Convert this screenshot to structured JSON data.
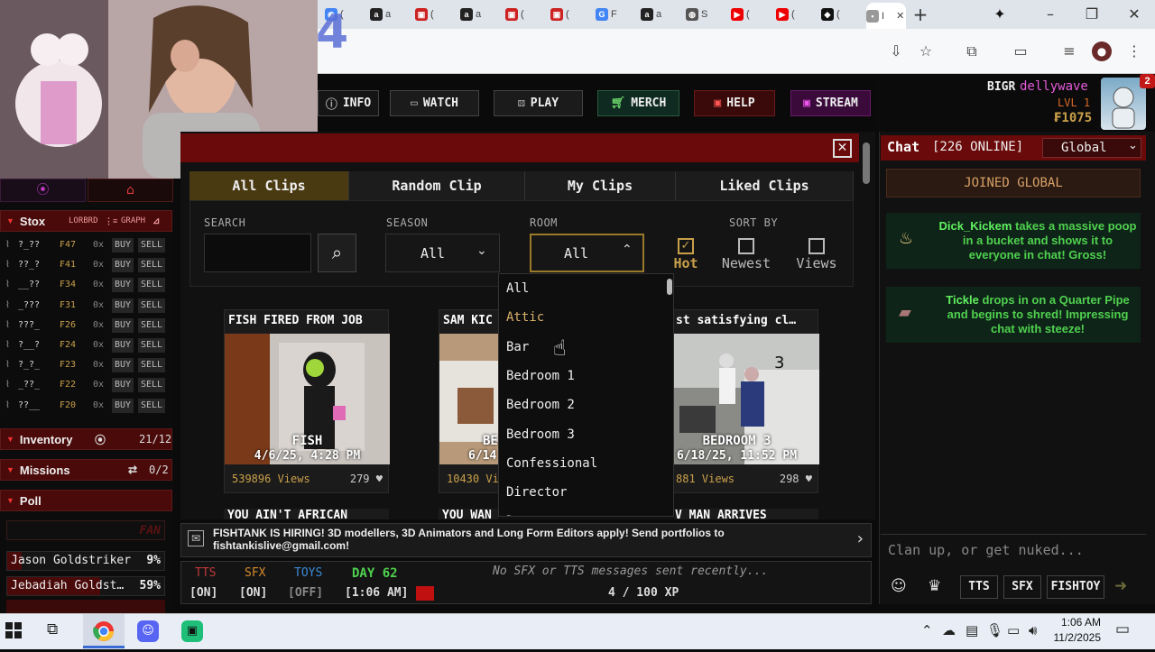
{
  "browser": {
    "tabs": [
      "(",
      "a",
      "(",
      "a",
      "(",
      "(",
      "F",
      "a",
      "S",
      "(",
      "(",
      "(",
      "I"
    ],
    "tab_icons": [
      "chrome-icon",
      "amazon-icon",
      "lolcow-icon",
      "amazon-icon",
      "lolcow-icon",
      "lolcow-icon",
      "google-icon",
      "amazon-icon",
      "site-icon",
      "youtube-icon",
      "youtube-icon",
      "fish-icon",
      "fishtank-icon"
    ],
    "overlay_number": "4"
  },
  "nav": {
    "info": "INFO",
    "watch": "WATCH",
    "play": "PLAY",
    "merch": "MERCH",
    "help": "HELP",
    "stream": "STREAM"
  },
  "user": {
    "tag": "BIGR",
    "name": "dellywave",
    "level": "LVL 1",
    "coins": "₣1075",
    "notif": "2"
  },
  "stox": {
    "title": "Stox",
    "lorbrd": "LORBRD",
    "graph": "GRAPH",
    "rows": [
      {
        "name": "?_??",
        "price": "₣47",
        "qty": "0x"
      },
      {
        "name": "??_?",
        "price": "₣41",
        "qty": "0x"
      },
      {
        "name": "__??",
        "price": "₣34",
        "qty": "0x"
      },
      {
        "name": "_???",
        "price": "₣31",
        "qty": "0x"
      },
      {
        "name": "???_",
        "price": "₣26",
        "qty": "0x"
      },
      {
        "name": "?__?",
        "price": "₣24",
        "qty": "0x"
      },
      {
        "name": "?_?_",
        "price": "₣23",
        "qty": "0x"
      },
      {
        "name": "_??_",
        "price": "₣22",
        "qty": "0x"
      },
      {
        "name": "??__",
        "price": "₣20",
        "qty": "0x"
      }
    ],
    "buy": "BUY",
    "sell": "SELL"
  },
  "inventory": {
    "title": "Inventory",
    "count": "21/12"
  },
  "missions": {
    "title": "Missions",
    "count": "0/2"
  },
  "poll": {
    "title": "Poll",
    "banner": "FAN",
    "options": [
      {
        "name": "Jason Goldstriker",
        "pct": "9%",
        "fill": 0.09
      },
      {
        "name": "Jebadiah Goldst…",
        "pct": "59%",
        "fill": 0.59
      }
    ]
  },
  "clips": {
    "tabs": [
      "All Clips",
      "Random Clip",
      "My Clips",
      "Liked Clips"
    ],
    "search_label": "SEARCH",
    "season_label": "SEASON",
    "season_value": "All",
    "room_label": "ROOM",
    "room_value": "All",
    "sort_label": "SORT BY",
    "sort": [
      {
        "label": "Hot",
        "checked": true
      },
      {
        "label": "Newest",
        "checked": false
      },
      {
        "label": "Views",
        "checked": false
      }
    ],
    "cards": [
      {
        "title": "FISH FIRED FROM JOB",
        "room": "FISH",
        "date": "4/6/25, 4:28 PM",
        "views": "539896 Views",
        "likes": "279"
      },
      {
        "title": "SAM KIC",
        "room": "BE",
        "date": "6/14",
        "views": "10430 Vi",
        "likes": ""
      },
      {
        "title": "st satisfying cl…",
        "room": "BEDROOM 3",
        "date": "6/18/25, 11:52 PM",
        "views": "881 Views",
        "likes": "298"
      }
    ],
    "next_row": [
      "YOU AIN'T AFRICAN",
      "YOU WAN",
      "V MAN ARRIVES"
    ],
    "room_options": [
      "All",
      "Attic",
      "Bar",
      "Bedroom 1",
      "Bedroom 2",
      "Bedroom 3",
      "Confessional",
      "Director",
      "Dorm"
    ]
  },
  "hiring": "FISHTANK IS HIRING! 3D modellers, 3D Animators and Long Form Editors apply! Send portfolios to fishtankislive@gmail.com!",
  "status": {
    "tts": "TTS",
    "tts_state": "[ON]",
    "sfx": "SFX",
    "sfx_state": "[ON]",
    "toys": "TOYS",
    "toys_state": "[OFF]",
    "day": "DAY 62",
    "time": "[1:06 AM]",
    "msg": "No SFX or TTS messages sent recently...",
    "xp": "4 / 100 XP"
  },
  "chat": {
    "title": "Chat",
    "online": "[226 ONLINE]",
    "channel": "Global",
    "joined": "JOINED GLOBAL",
    "messages": [
      {
        "user": "Dick_Kickem",
        "text": " takes a massive poop in a bucket and shows it to everyone in chat! Gross!"
      },
      {
        "user": "Tickle",
        "text": " drops in on a Quarter Pipe and begins to shred! Impressing chat with steeze!"
      }
    ],
    "placeholder": "Clan up, or get nuked...",
    "buttons": [
      "TTS",
      "SFX",
      "FISHTOY"
    ]
  },
  "taskbar": {
    "time": "1:06 AM",
    "date": "11/2/2025"
  },
  "colors": {
    "accent_red": "#8b0a0a",
    "gold": "#c9a04a",
    "green_text": "#4fd14f",
    "chat_header": "#6b0a0a"
  }
}
